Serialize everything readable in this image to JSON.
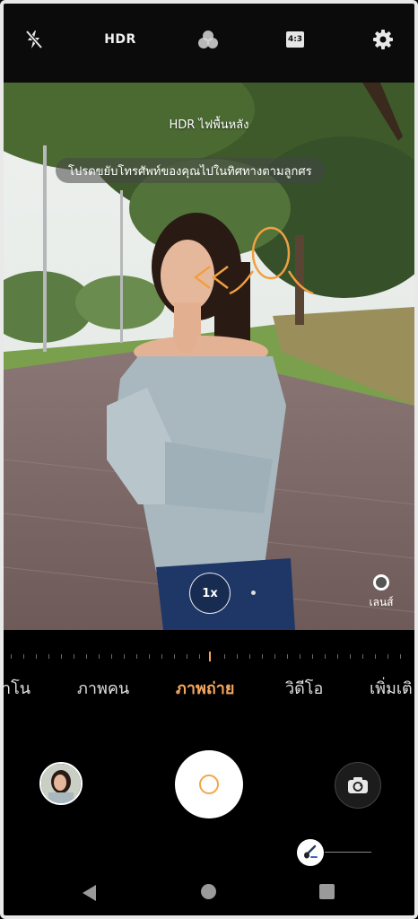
{
  "top_bar": {
    "flash_icon": "flash-off-icon",
    "hdr_label": "HDR",
    "filter_icon": "filters-icon",
    "ratio_label": "4:3",
    "settings_icon": "gear-icon"
  },
  "viewfinder": {
    "hint_top": "HDR ไฟพื้นหลัง",
    "hint_pill": "โปรดขยับโทรศัพท์ของคุณไปในทิศทางตามลูกศร",
    "zoom_label": "1x",
    "lens_label": "เลนส์"
  },
  "modes": {
    "items": [
      "าโน",
      "ภาพคน",
      "ภาพถ่าย",
      "วิดีโอ",
      "เพิ่มเติ"
    ],
    "active": "ภาพถ่าย"
  },
  "controls": {
    "gallery_icon": "gallery-thumbnail",
    "shutter_icon": "shutter-icon",
    "switch_icon": "switch-camera-icon",
    "beauty_icon": "beauty-brush-icon"
  },
  "colors": {
    "accent": "#f3a75e",
    "shutter_ring": "#f2a64a"
  }
}
